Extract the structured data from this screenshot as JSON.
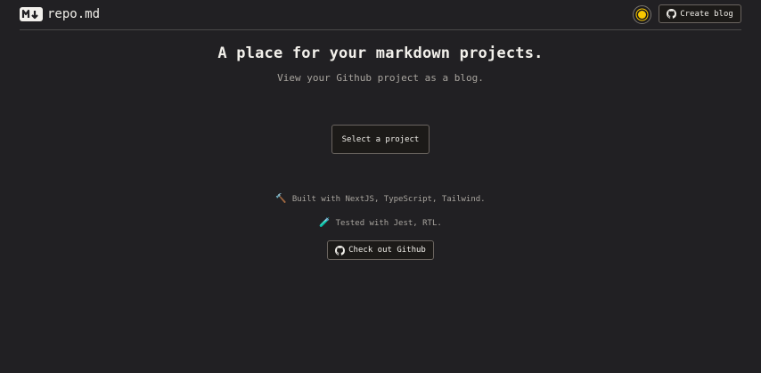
{
  "header": {
    "logo_text": "repo.md",
    "logo_badge": "M↓",
    "theme_icon": "sun-icon",
    "create_blog_label": "Create blog"
  },
  "hero": {
    "title": "A place for your markdown projects.",
    "subtitle": "View your Github project as a blog."
  },
  "actions": {
    "select_project_label": "Select a project",
    "github_label": "Check out Github"
  },
  "footer": {
    "built_text": "Built with NextJS, TypeScript, Tailwind.",
    "tested_text": "Tested with Jest, RTL.",
    "built_icon": "hammer-icon",
    "tested_icon": "test-tube-icon"
  },
  "colors": {
    "background": "#212023",
    "accent": "#f7c800"
  }
}
